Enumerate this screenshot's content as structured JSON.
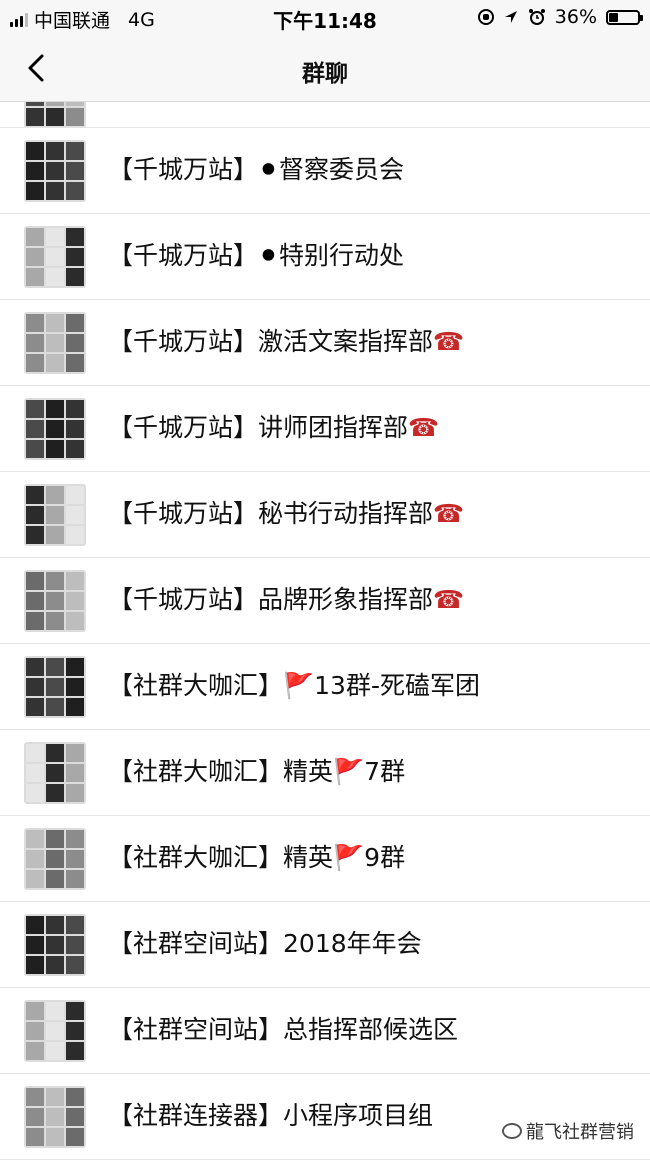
{
  "status_bar": {
    "carrier": "中国联通",
    "network": "4G",
    "time": "下午11:48",
    "battery": "36%",
    "battery_level": 0.36
  },
  "nav": {
    "title": "群聊",
    "back_icon": "chevron-left-icon"
  },
  "groups": [
    {
      "prefix": "【千城万站】",
      "name": "督察委员会",
      "emoji_before": "⚫",
      "emoji_after": ""
    },
    {
      "prefix": "【千城万站】",
      "name": "特别行动处",
      "emoji_before": "⚫",
      "emoji_after": ""
    },
    {
      "prefix": "【千城万站】",
      "name": "激活文案指挥部",
      "emoji_before": "",
      "emoji_after": "☎"
    },
    {
      "prefix": "【千城万站】",
      "name": "讲师团指挥部",
      "emoji_before": "",
      "emoji_after": "☎"
    },
    {
      "prefix": "【千城万站】",
      "name": "秘书行动指挥部",
      "emoji_before": "",
      "emoji_after": "☎"
    },
    {
      "prefix": "【千城万站】",
      "name": "品牌形象指挥部",
      "emoji_before": "",
      "emoji_after": "☎"
    },
    {
      "prefix": "【社群大咖汇】",
      "name": "13群-死磕军团",
      "emoji_before": "🚩",
      "emoji_after": ""
    },
    {
      "prefix": "【社群大咖汇】",
      "name": "精英",
      "emoji_before": "",
      "emoji_after": "🚩",
      "suffix": "7群"
    },
    {
      "prefix": "【社群大咖汇】",
      "name": "精英",
      "emoji_before": "",
      "emoji_after": "🚩",
      "suffix": "9群"
    },
    {
      "prefix": "【社群空间站】",
      "name": "2018年年会",
      "emoji_before": "",
      "emoji_after": ""
    },
    {
      "prefix": "【社群空间站】",
      "name": "总指挥部候选区",
      "emoji_before": "",
      "emoji_after": ""
    },
    {
      "prefix": "【社群连接器】",
      "name": "小程序项目组",
      "emoji_before": "",
      "emoji_after": ""
    }
  ],
  "watermark": "龍飞社群营销",
  "colors": {
    "accent_red": "#c62828",
    "bar_bg": "#f7f7f7"
  }
}
